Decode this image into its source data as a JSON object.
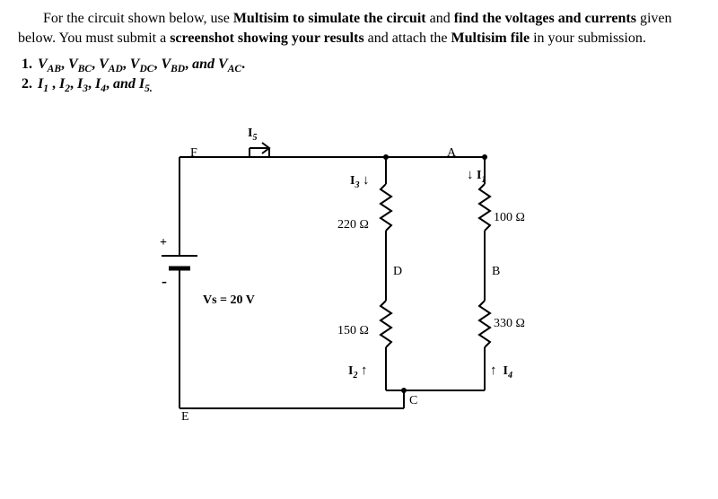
{
  "para": {
    "t1": "For the circuit shown below, use ",
    "t2": "Multisim to simulate the circuit",
    "t3": " and ",
    "t4": "find the voltages and currents",
    "t5": " given below. You must submit a ",
    "t6": "screenshot showing your results",
    "t7": " and attach the ",
    "t8": " Multisim file ",
    "t9": " in your submission."
  },
  "list1": {
    "num": "1. ",
    "v1a": "V",
    "v1b": "AB",
    "v2a": "V",
    "v2b": "BC",
    "v3a": "V",
    "v3b": "AD",
    "v4a": "V",
    "v4b": "DC",
    "v5a": "V",
    "v5b": "BD",
    "v6a": "V",
    "v6b": "AC",
    "comma": ", ",
    "and": " and ",
    "dot": "."
  },
  "list2": {
    "num": "2.  ",
    "i1a": "I",
    "i1b": "1",
    "i2a": "I",
    "i2b": "2",
    "i3a": "I",
    "i3b": "3",
    "i4a": "I",
    "i4b": "4",
    "i5a": "I",
    "i5b": "5.",
    "sep1": " , ",
    "sep": ", ",
    "and": " and "
  },
  "circuit": {
    "source": "Vs = 20 V",
    "plus": "+",
    "minus": "-",
    "r220": "220 Ω",
    "r150": "150 Ω",
    "r100": "100 Ω",
    "r330": "330 Ω",
    "nA": "A",
    "nB": "B",
    "nC": "C",
    "nD": "D",
    "nE": "E",
    "nF": "F",
    "i1": "I",
    "i1s": "1",
    "i2": "I",
    "i2s": "2",
    "i3": "I",
    "i3s": "3",
    "i4": "I",
    "i4s": "4",
    "i5": "I",
    "i5s": "5",
    "ad": "↓",
    "au": "↑",
    "ar": "→"
  }
}
